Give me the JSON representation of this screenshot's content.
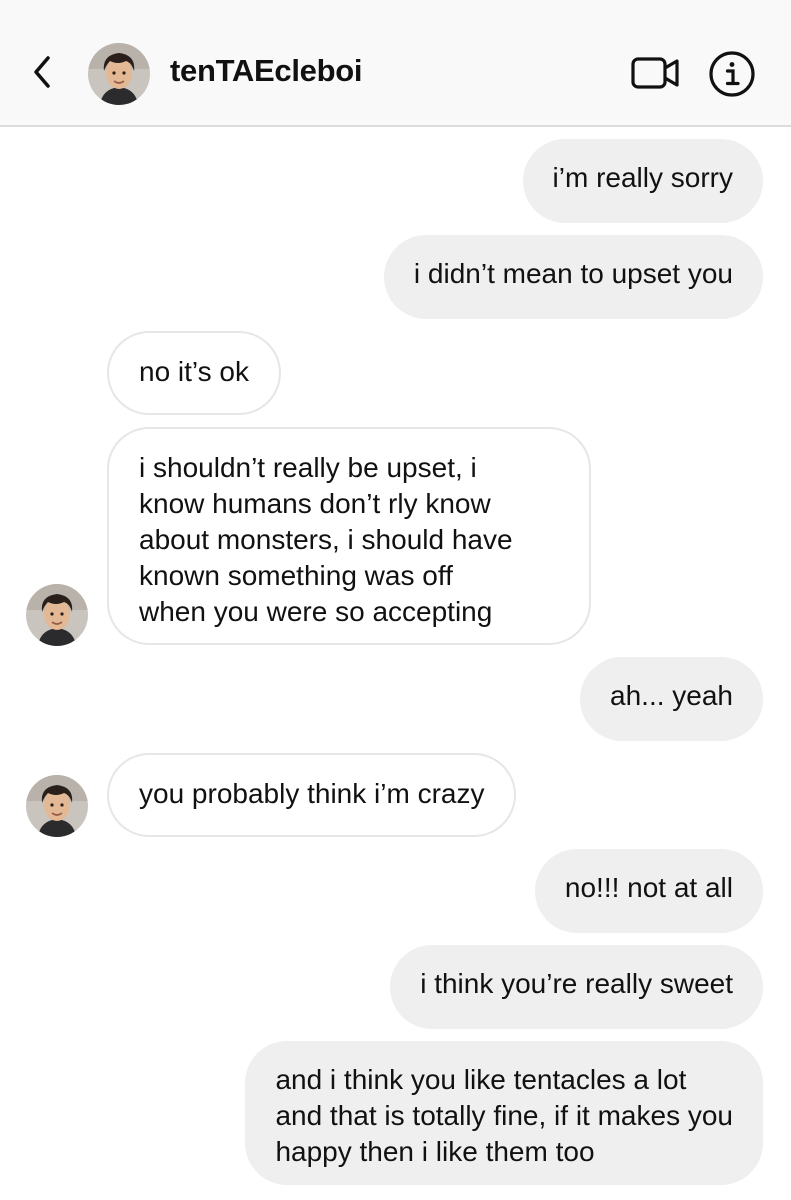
{
  "header": {
    "username": "tenTAEcleboi",
    "back_icon": "chevron-left-icon",
    "video_icon": "video-camera-icon",
    "info_icon": "info-circle-icon"
  },
  "messages": [
    {
      "side": "sent",
      "text": "i’m really sorry"
    },
    {
      "side": "sent",
      "text": "i didn’t mean to upset you"
    },
    {
      "side": "received",
      "text": "no it’s ok"
    },
    {
      "side": "received",
      "text": "i shouldn’t really be upset, i\nknow humans don’t rly know\nabout monsters, i should have\nknown something was off\nwhen you were so accepting"
    },
    {
      "side": "sent",
      "text": "ah... yeah"
    },
    {
      "side": "received",
      "text": "you probably think i’m crazy"
    },
    {
      "side": "sent",
      "text": "no!!! not at all"
    },
    {
      "side": "sent",
      "text": "i think you’re really sweet"
    },
    {
      "side": "sent",
      "text": "and i think you like tentacles a lot\nand that is totally fine, if it makes you\nhappy then i like them too"
    }
  ],
  "colors": {
    "sent_bubble": "#efefef",
    "received_border": "#e6e6e6",
    "header_bg": "#f9f9f9"
  }
}
